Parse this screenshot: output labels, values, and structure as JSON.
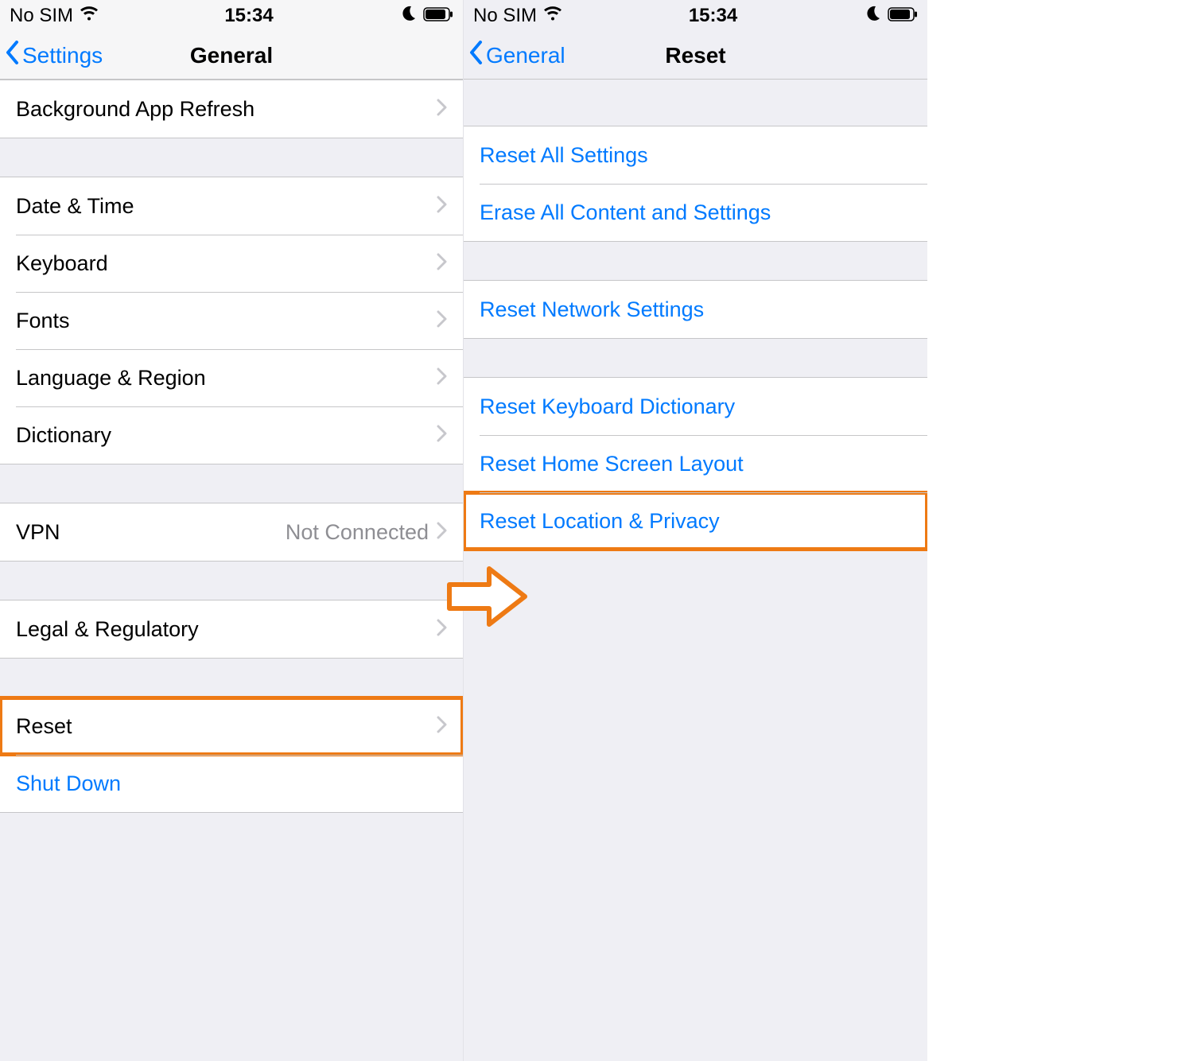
{
  "status": {
    "carrier": "No SIM",
    "time": "15:34"
  },
  "colors": {
    "link": "#007aff",
    "highlight": "#ee7a14",
    "groupbg": "#efeff4",
    "detail": "#8e8e93"
  },
  "left": {
    "nav": {
      "back": "Settings",
      "title": "General"
    },
    "sections": [
      {
        "rows": [
          {
            "label": "Background App Refresh",
            "chevron": true
          }
        ]
      },
      {
        "rows": [
          {
            "label": "Date & Time",
            "chevron": true
          },
          {
            "label": "Keyboard",
            "chevron": true
          },
          {
            "label": "Fonts",
            "chevron": true
          },
          {
            "label": "Language & Region",
            "chevron": true
          },
          {
            "label": "Dictionary",
            "chevron": true
          }
        ]
      },
      {
        "rows": [
          {
            "label": "VPN",
            "detail": "Not Connected",
            "chevron": true
          }
        ]
      },
      {
        "rows": [
          {
            "label": "Legal & Regulatory",
            "chevron": true
          }
        ]
      },
      {
        "rows": [
          {
            "label": "Reset",
            "chevron": true,
            "highlight": true
          },
          {
            "label": "Shut Down",
            "blue": true
          }
        ]
      }
    ]
  },
  "right": {
    "nav": {
      "back": "General",
      "title": "Reset"
    },
    "sections": [
      {
        "rows": [
          {
            "label": "Reset All Settings"
          },
          {
            "label": "Erase All Content and Settings"
          }
        ]
      },
      {
        "rows": [
          {
            "label": "Reset Network Settings"
          }
        ]
      },
      {
        "rows": [
          {
            "label": "Reset Keyboard Dictionary"
          },
          {
            "label": "Reset Home Screen Layout"
          },
          {
            "label": "Reset Location & Privacy",
            "highlight": true
          }
        ]
      }
    ]
  }
}
